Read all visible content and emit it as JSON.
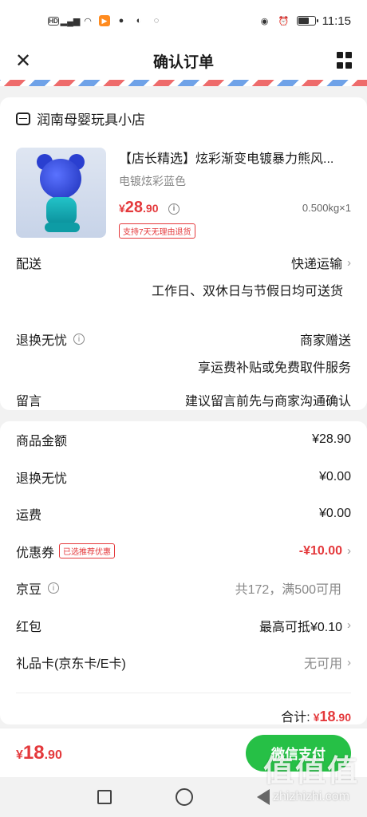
{
  "status_bar": {
    "hd": "HD",
    "network": "4G",
    "time": "11:15",
    "battery_level": 0.7
  },
  "header": {
    "title": "确认订单",
    "close_icon": "close-icon",
    "menu_icon": "grid-icon"
  },
  "shop": {
    "name": "润南母婴玩具小店",
    "icon": "shop-icon"
  },
  "product": {
    "title": "【店长精选】炫彩渐变电镀暴力熊风...",
    "spec": "电镀炫彩蓝色",
    "price_symbol": "¥",
    "price_int": "28",
    "price_dec": ".90",
    "quantity": "0.500kg×1",
    "return_tag": "支持7天无理由退货"
  },
  "delivery": {
    "label": "配送",
    "value": "快递运输",
    "note": "工作日、双休日与节假日均可送货"
  },
  "return_worry": {
    "label": "退换无忧",
    "value": "商家赠送",
    "note": "享运费补贴或免费取件服务"
  },
  "message": {
    "label": "留言",
    "placeholder": "建议留言前先与商家沟通确认"
  },
  "summary": {
    "goods_amount_label": "商品金额",
    "goods_amount": "¥28.90",
    "return_worry_label": "退换无忧",
    "return_worry_amount": "¥0.00",
    "shipping_label": "运费",
    "shipping_amount": "¥0.00",
    "coupon_label": "优惠券",
    "coupon_tag": "已选推荐优惠",
    "coupon_amount": "-¥10.00",
    "jingdou_label": "京豆",
    "jingdou_value": "共172，满500可用",
    "redpacket_label": "红包",
    "redpacket_value": "最高可抵¥0.10",
    "giftcard_label": "礼品卡(京东卡/E卡)",
    "giftcard_value": "无可用",
    "total_label": "合计:",
    "total_symbol": "¥",
    "total_int": "18",
    "total_dec": ".90"
  },
  "paybar": {
    "price_symbol": "¥",
    "price_int": "18",
    "price_dec": ".90",
    "pay_button": "微信支付"
  },
  "watermark": {
    "mark": "值值值",
    "url": "zhizhizhi.com"
  },
  "colors": {
    "accent": "#e4393c",
    "pay_green": "#26c046"
  }
}
